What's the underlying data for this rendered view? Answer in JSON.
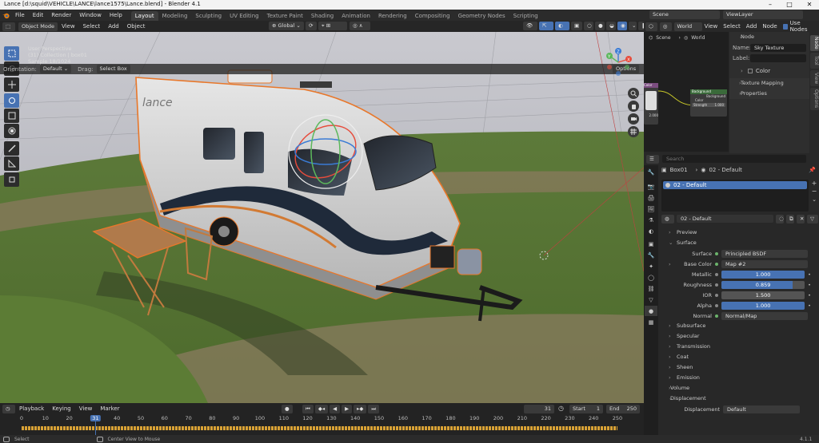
{
  "window": {
    "title": "Lance [d:\\squid\\VEHICLE\\LANCE\\lance1575\\Lance.blend] - Blender 4.1",
    "min": "–",
    "max": "□",
    "close": "✕"
  },
  "menu": [
    "File",
    "Edit",
    "Render",
    "Window",
    "Help"
  ],
  "workspaces": [
    "Layout",
    "Modeling",
    "Sculpting",
    "UV Editing",
    "Texture Paint",
    "Shading",
    "Animation",
    "Rendering",
    "Compositing",
    "Geometry Nodes",
    "Scripting"
  ],
  "scene": {
    "label": "Scene",
    "viewlayer": "ViewLayer"
  },
  "viewport": {
    "mode": "Object Mode",
    "menus": [
      "View",
      "Select",
      "Add",
      "Object"
    ],
    "transform": "Global",
    "orientation_label": "Orientation:",
    "orientation": "Default",
    "drag_label": "Drag:",
    "drag": "Select Box",
    "options": "Options",
    "overlay": [
      "User Perspective",
      "(31) Collection | box01",
      "Sample 18/1024"
    ],
    "axes": {
      "x": "X",
      "y": "Y",
      "z": "Z"
    }
  },
  "timeline": {
    "menus": [
      "Playback",
      "Keying",
      "View",
      "Marker"
    ],
    "current": "31",
    "start_label": "Start",
    "start": "1",
    "end_label": "End",
    "end": "250",
    "ticks": [
      "0",
      "10",
      "20",
      "31",
      "40",
      "50",
      "60",
      "70",
      "80",
      "90",
      "100",
      "110",
      "120",
      "130",
      "140",
      "150",
      "160",
      "170",
      "180",
      "190",
      "200",
      "210",
      "220",
      "230",
      "240",
      "250"
    ]
  },
  "status": {
    "left": "Select",
    "mid": "Center View to Mouse",
    "version": "4.1.1"
  },
  "node_editor": {
    "menus": [
      "View",
      "Select",
      "Add",
      "Node"
    ],
    "world": "World",
    "use_nodes": "Use Nodes",
    "breadcrumb": [
      "Scene",
      "World"
    ],
    "panel_title": "Node",
    "name_label": "Name:",
    "name": "Sky Texture",
    "label_label": "Label:",
    "color": "Color",
    "sections": [
      "Texture Mapping",
      "Properties"
    ],
    "node_bg_title": "Background",
    "node_bg_out": "Background",
    "node_bg_color": "Color",
    "node_bg_strength": "Strength",
    "node_bg_strength_val": "1.000",
    "node_tex_title": "Color",
    "node_tex_val": "2.000"
  },
  "side_tabs": [
    "Node",
    "Tool",
    "View",
    "Options"
  ],
  "properties": {
    "search": "Search",
    "object": "Box01",
    "material": "02 - Default",
    "slot": "02 - Default",
    "material_field": "02 - Default",
    "preview": "Preview",
    "surface_section": "Surface",
    "rows": [
      {
        "label": "Surface",
        "value": "Principled BSDF",
        "type": "node"
      },
      {
        "label": "Base Color",
        "value": "Map #2",
        "type": "node"
      },
      {
        "label": "Metallic",
        "value": "1.000",
        "fill": 1.0
      },
      {
        "label": "Roughness",
        "value": "0.859",
        "fill": 0.859
      },
      {
        "label": "IOR",
        "value": "1.500",
        "fill": 0
      },
      {
        "label": "Alpha",
        "value": "1.000",
        "fill": 1.0
      },
      {
        "label": "Normal",
        "value": "Normal/Map",
        "type": "node"
      }
    ],
    "subsections": [
      "Subsurface",
      "Specular",
      "Transmission",
      "Coat",
      "Sheen",
      "Emission"
    ],
    "volume": "Volume",
    "displacement": "Displacement",
    "disp_label": "Displacement",
    "disp_value": "Default"
  },
  "colors": {
    "accent": "#4772b3",
    "selection": "#e8772a"
  }
}
